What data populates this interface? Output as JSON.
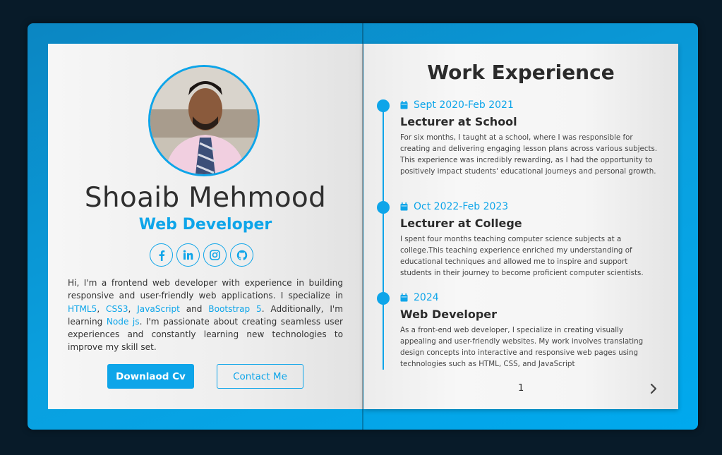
{
  "profile": {
    "name": "Shoaib Mehmood",
    "role": "Web Developer",
    "bio_intro": "Hi, I'm a frontend web developer with experience in building responsive and user-friendly web applications. I specialize in ",
    "skills": [
      "HTML5",
      "CSS3",
      "JavaScript",
      "Bootstrap 5"
    ],
    "sep_1": ", ",
    "sep_2": ", ",
    "sep_3": " and ",
    "bio_mid": ". Additionally, I'm learning ",
    "learning": "Node js",
    "bio_end": ". I'm passionate about creating seamless user experiences and constantly learning new technologies to improve my skill set.",
    "socials": [
      "facebook-icon",
      "linkedin-icon",
      "instagram-icon",
      "github-icon"
    ],
    "download_label": "Downlaod Cv",
    "contact_label": "Contact Me"
  },
  "experience": {
    "heading": "Work Experience",
    "items": [
      {
        "date": "Sept 2020-Feb 2021",
        "title": "Lecturer at School",
        "description": "For six months, I taught at a school, where I was responsible for creating and delivering engaging lesson plans across various subjects. This experience was incredibly rewarding, as I had the opportunity to positively impact students' educational journeys and personal growth."
      },
      {
        "date": "Oct 2022-Feb 2023",
        "title": "Lecturer at College",
        "description": "I spent four months teaching computer science subjects at a college.This teaching experience enriched my understanding of educational techniques and allowed me to inspire and support students in their journey to become proficient computer scientists."
      },
      {
        "date": "2024",
        "title": "Web Developer",
        "description": "As a front-end web developer, I specialize in creating visually appealing and user-friendly websites. My work involves translating design concepts into interactive and responsive web pages using technologies such as HTML, CSS, and JavaScript"
      }
    ],
    "page_number": "1"
  },
  "colors": {
    "accent": "#0ea5e9",
    "background": "#081b29",
    "text_dark": "#2f2f2f"
  }
}
